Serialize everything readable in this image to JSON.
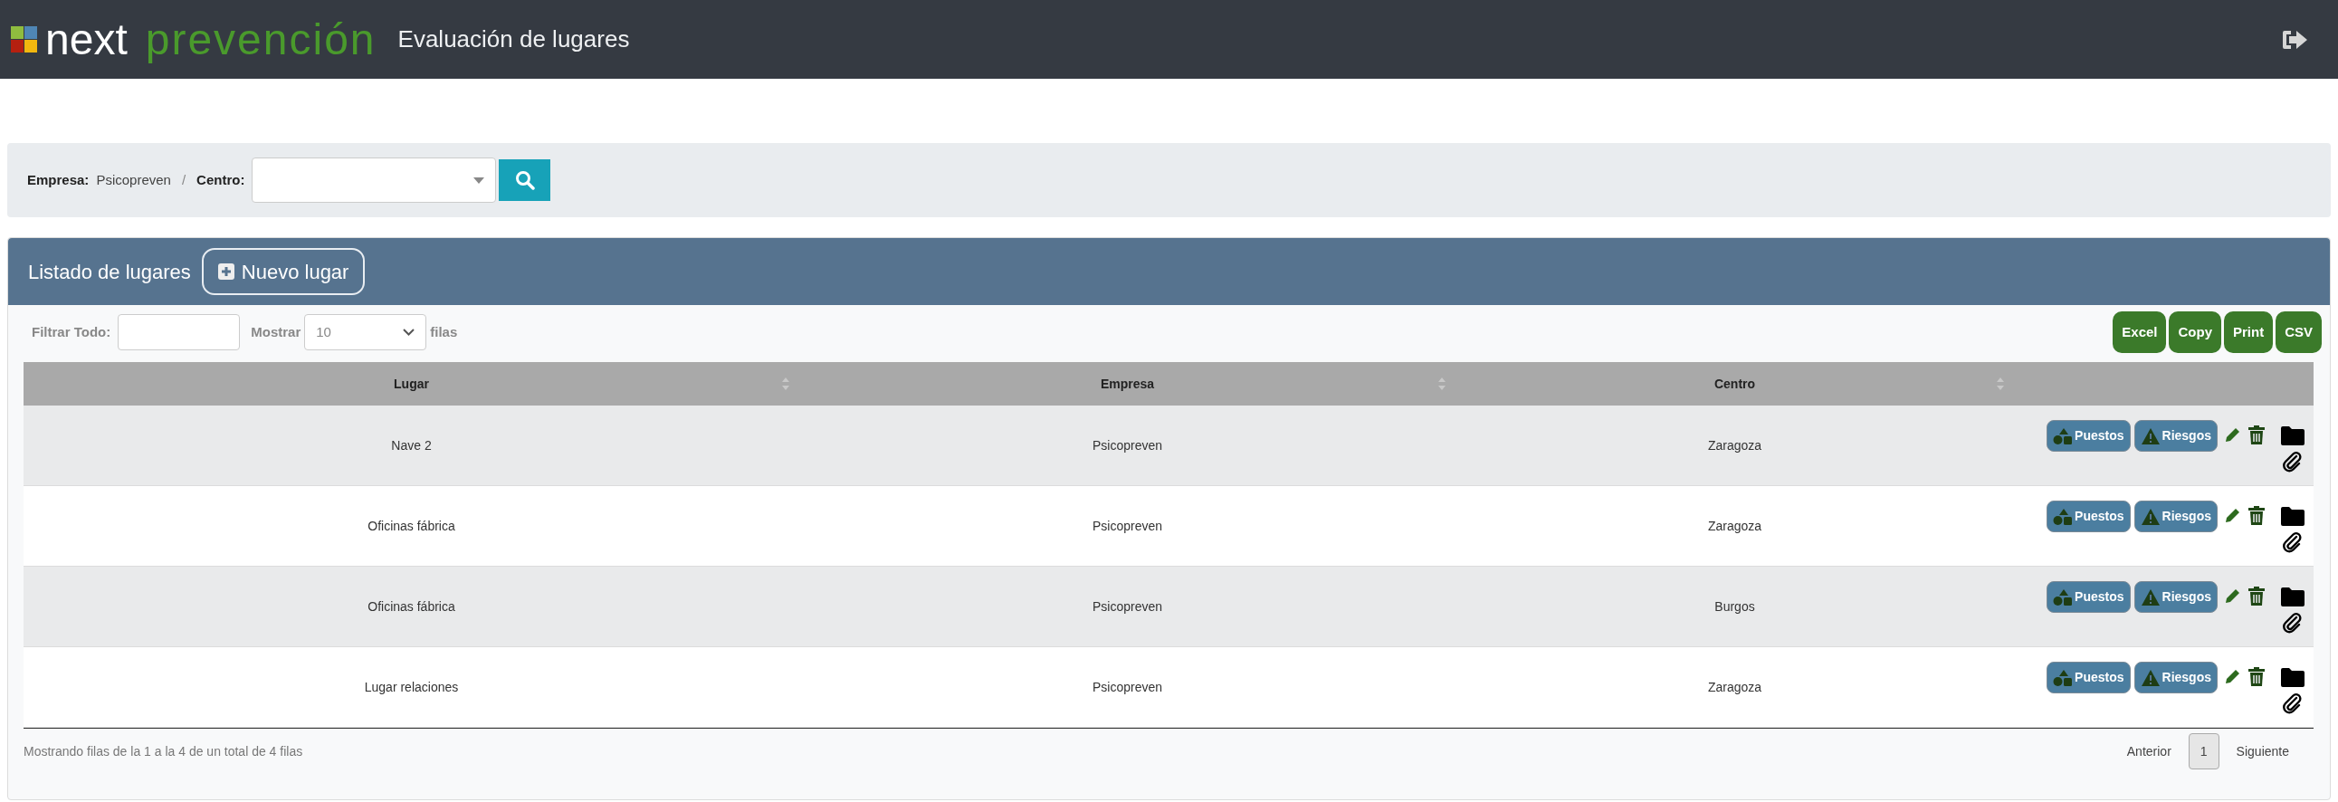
{
  "header": {
    "logo_word_1": "next",
    "logo_word_2": "prevención",
    "title": "Evaluación de lugares"
  },
  "filter": {
    "empresa_label": "Empresa:",
    "empresa_value": "Psicopreven",
    "separator": "/",
    "centro_label": "Centro:"
  },
  "panel": {
    "title": "Listado de lugares",
    "new_button": "Nuevo lugar",
    "toolbar": {
      "filter_label": "Filtrar Todo:",
      "show_label": "Mostrar",
      "show_value": "10",
      "rows_label": "filas",
      "export_buttons": [
        "Excel",
        "Copy",
        "Print",
        "CSV"
      ]
    },
    "table": {
      "columns": [
        {
          "label": "Lugar",
          "sortable": true
        },
        {
          "label": "Empresa",
          "sortable": true
        },
        {
          "label": "Centro",
          "sortable": true
        }
      ],
      "rows": [
        {
          "lugar": "Nave 2",
          "empresa": "Psicopreven",
          "centro": "Zaragoza",
          "actions": [
            "Puestos",
            "Riesgos"
          ]
        },
        {
          "lugar": "Oficinas fábrica",
          "empresa": "Psicopreven",
          "centro": "Zaragoza",
          "actions": [
            "Puestos",
            "Riesgos"
          ]
        },
        {
          "lugar": "Oficinas fábrica",
          "empresa": "Psicopreven",
          "centro": "Burgos",
          "actions": [
            "Puestos",
            "Riesgos"
          ]
        },
        {
          "lugar": "Lugar relaciones",
          "empresa": "Psicopreven",
          "centro": "Zaragoza",
          "actions": [
            "Puestos",
            "Riesgos"
          ]
        }
      ]
    },
    "footer": {
      "info": "Mostrando filas de la 1 a la 4 de un total de 4 filas",
      "pagination": [
        {
          "label": "Anterior",
          "selected": false
        },
        {
          "label": "1",
          "selected": true
        },
        {
          "label": "Siguiente",
          "selected": false
        }
      ]
    }
  }
}
